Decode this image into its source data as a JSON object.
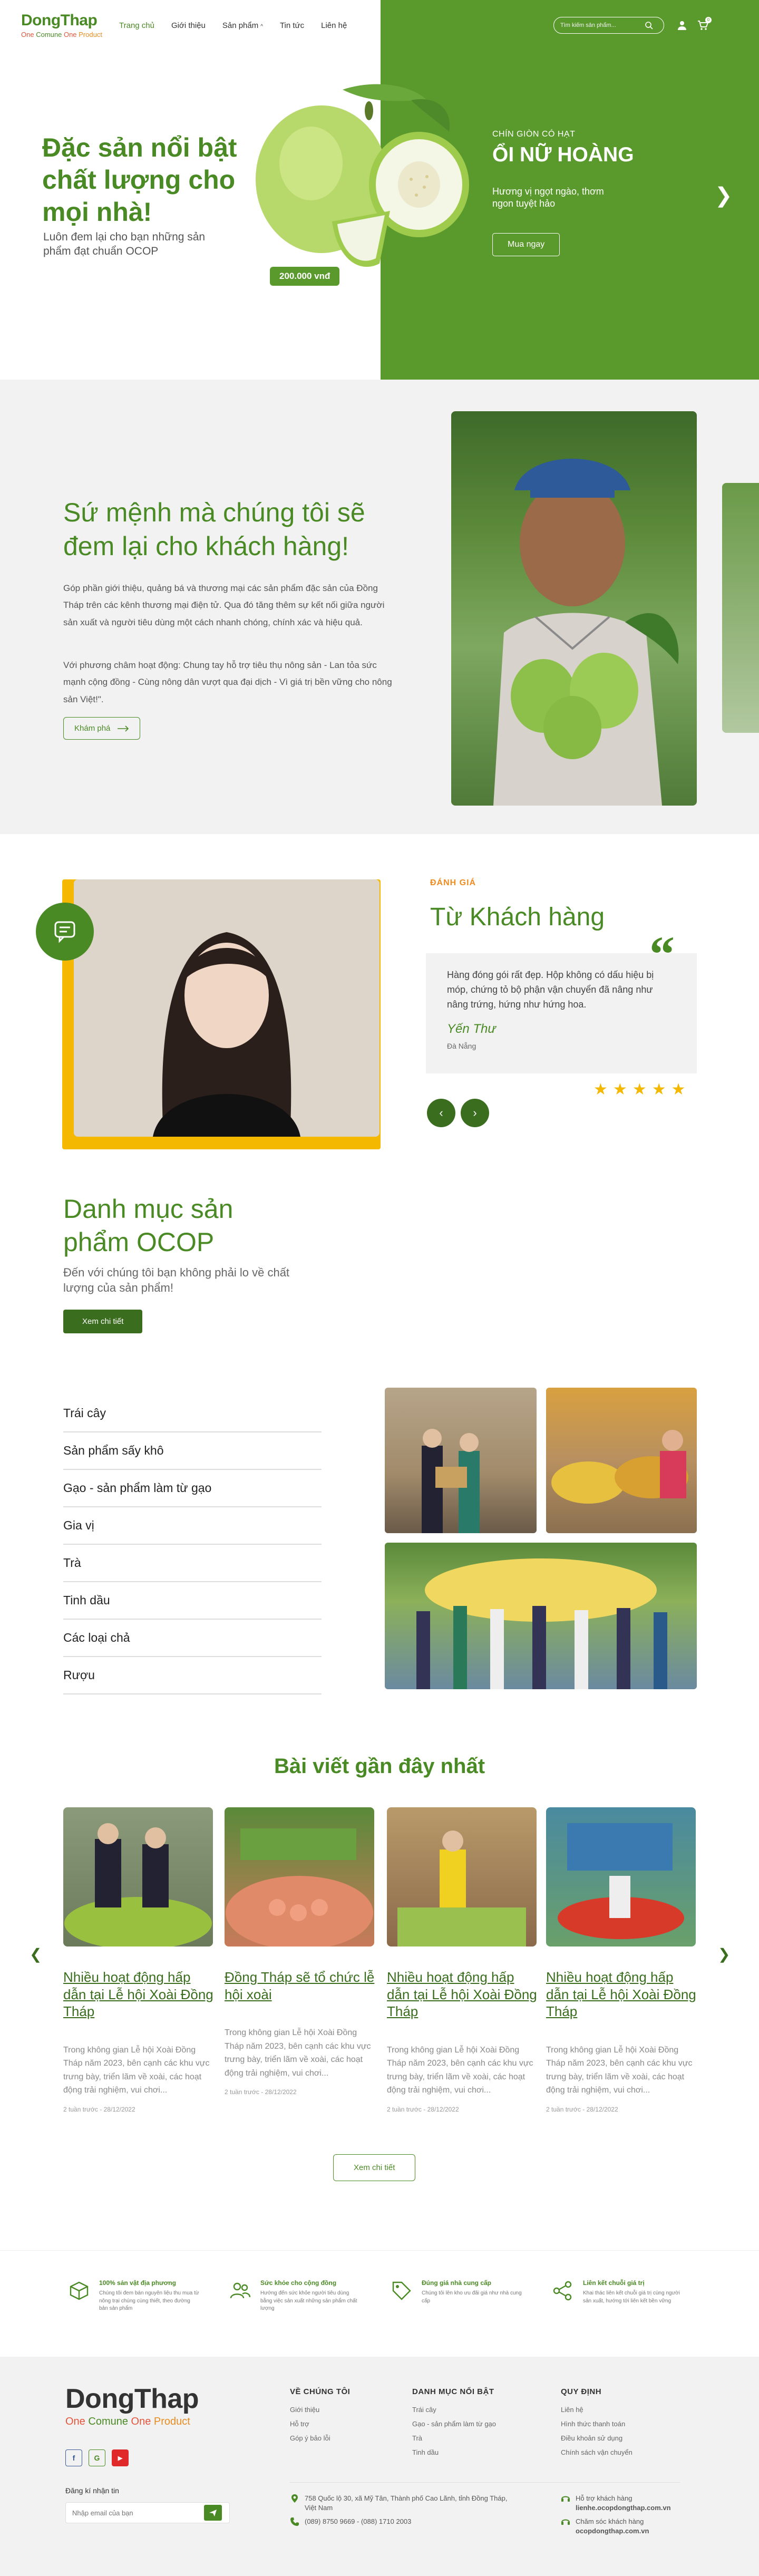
{
  "header": {
    "brand": "DongThap",
    "tagline": [
      "One",
      "Comune",
      "One",
      "Product"
    ],
    "nav": [
      "Trang chủ",
      "Giới thiệu",
      "Sản phẩm",
      "Tin tức",
      "Liên hệ"
    ],
    "search_placeholder": "Tìm kiếm sản phẩm...",
    "cart_count": "0"
  },
  "hero": {
    "title": "Đặc sản nổi bật chất lượng cho mọi nhà!",
    "description": "Luôn đem lại cho bạn những sản phẩm đạt chuẩn OCOP",
    "price": "200.000 vnđ",
    "kicker": "CHÍN GIÒN CÓ HẠT",
    "product": "ỔI NỮ HOÀNG",
    "product_desc": "Hương vị ngọt ngào, thơm ngon tuyệt hảo",
    "cta": "Mua ngay"
  },
  "mission": {
    "title": "Sứ mệnh mà chúng tôi sẽ đem lại cho khách hàng!",
    "p1": "Góp phần giới thiệu, quảng bá và thương mại các sản phẩm đặc sản của Đồng Tháp trên các kênh thương mại điện tử. Qua đó tăng thêm sự kết nối giữa người sản xuất và người tiêu dùng một cách nhanh chóng, chính xác và hiệu quả.",
    "p2": "Với phương châm hoạt động: Chung tay hỗ trợ tiêu thụ nông sản - Lan tỏa sức mạnh cộng đồng - Cùng nông dân vượt qua đại dịch - Vì giá trị bền vững cho nông sản Việt!\".",
    "cta": "Khám phá"
  },
  "testimonial": {
    "kicker": "ĐÁNH GIÁ",
    "title": "Từ Khách hàng",
    "text": "Hàng đóng gói rất đẹp. Hộp không có dấu hiệu bị móp, chứng tỏ bộ phận vận chuyển đã nâng như nâng trứng, hứng như hứng hoa.",
    "name": "Yến Thư",
    "place": "Đà Nẵng",
    "rating": 5
  },
  "categories": {
    "title": "Danh mục sản phẩm OCOP",
    "subtitle": "Đến với chúng tôi bạn không phải lo về chất lượng của sản phẩm!",
    "cta": "Xem chi tiết",
    "items": [
      "Trái cây",
      "Sản phẩm sấy khô",
      "Gạo - sản phẩm làm từ gạo",
      "Gia vị",
      "Trà",
      "Tinh dầu",
      "Các loại chả",
      "Rượu"
    ]
  },
  "blog": {
    "title": "Bài viết gần đây nhất",
    "posts": [
      {
        "title": "Nhiều hoạt động hấp dẫn tại Lễ hội Xoài Đồng Tháp",
        "excerpt": "Trong không gian Lễ hội Xoài Đồng Tháp năm 2023, bên cạnh các khu vực trưng bày, triển lãm về xoài, các hoạt động trải nghiệm, vui chơi...",
        "meta": "2 tuần trước - 28/12/2022"
      },
      {
        "title": "Đồng Tháp sẽ tổ chức lễ hội xoài",
        "excerpt": "Trong không gian Lễ hội Xoài Đồng Tháp năm 2023, bên cạnh các khu vực trưng bày, triển lãm về xoài, các hoạt động trải nghiệm, vui chơi...",
        "meta": "2 tuần trước - 28/12/2022"
      },
      {
        "title": "Nhiều hoạt động hấp dẫn tại Lễ hội Xoài Đồng Tháp",
        "excerpt": "Trong không gian Lễ hội Xoài Đồng Tháp năm 2023, bên cạnh các khu vực trưng bày, triển lãm về xoài, các hoạt động trải nghiệm, vui chơi...",
        "meta": "2 tuần trước - 28/12/2022"
      },
      {
        "title": "Nhiều hoạt động hấp dẫn tại Lễ hội Xoài Đồng Tháp",
        "excerpt": "Trong không gian Lễ hội Xoài Đồng Tháp năm 2023, bên cạnh các khu vực trưng bày, triển lãm về xoài, các hoạt động trải nghiệm, vui chơi...",
        "meta": "2 tuần trước - 28/12/2022"
      }
    ],
    "more": "Xem chi tiết"
  },
  "features": [
    {
      "title": "100% sản vật địa phương",
      "desc": "Chúng tôi đem bán nguyên liệu thu mua từ nông trại chúng cùng thiết, theo đường bản sản phẩm"
    },
    {
      "title": "Sức khỏe cho cộng đồng",
      "desc": "Hướng đến sức khỏe người tiêu dùng bằng việc sản xuất những sản phẩm chất lượng"
    },
    {
      "title": "Đúng giá nhà cung cấp",
      "desc": "Chúng tôi lên kho ưu đãi giá như nhà cung cấp"
    },
    {
      "title": "Liên kết chuỗi giá trị",
      "desc": "Khai thác liên kết chuỗi giá trị cùng người sản xuất, hướng tới liên kết bền vững"
    }
  ],
  "footer": {
    "brand": "DongThap",
    "tagline": [
      "One",
      "Comune",
      "One",
      "Product"
    ],
    "socials": [
      "f",
      "G",
      "▶"
    ],
    "newsletter_label": "Đăng kí nhận tin",
    "newsletter_placeholder": "Nhập email của bạn",
    "col1": {
      "title": "VỀ CHÚNG TÔI",
      "links": [
        "Giới thiệu",
        "Hỗ trợ",
        "Góp ý bảo lỗi"
      ]
    },
    "col2": {
      "title": "DANH MỤC NỔI BẬT",
      "links": [
        "Trái cây",
        "Gạo - sản phẩm làm từ gạo",
        "Trà",
        "Tinh dầu"
      ]
    },
    "col3": {
      "title": "QUY ĐỊNH",
      "links": [
        "Liên hệ",
        "Hình thức thanh toán",
        "Điều khoản sử dụng",
        "Chính sách vận chuyển"
      ]
    },
    "address": "758 Quốc lộ 30, xã Mỹ Tân, Thành phố Cao Lãnh, tỉnh Đồng Tháp, Việt Nam",
    "phone": "(089) 8750 9669 - (088) 1710 2003",
    "support1_label": "Hỗ trợ khách hàng",
    "support1_email": "lienhe.ocopdongthap.com.vn",
    "support2_label": "Chăm sóc khách hàng",
    "support2_email": "ocopdongthap.com.vn"
  },
  "colors": {
    "brand_green": "#5a9a2c",
    "dark_green": "#3a6e1e",
    "accent_yellow": "#f5b800",
    "accent_orange": "#f08c1f"
  }
}
